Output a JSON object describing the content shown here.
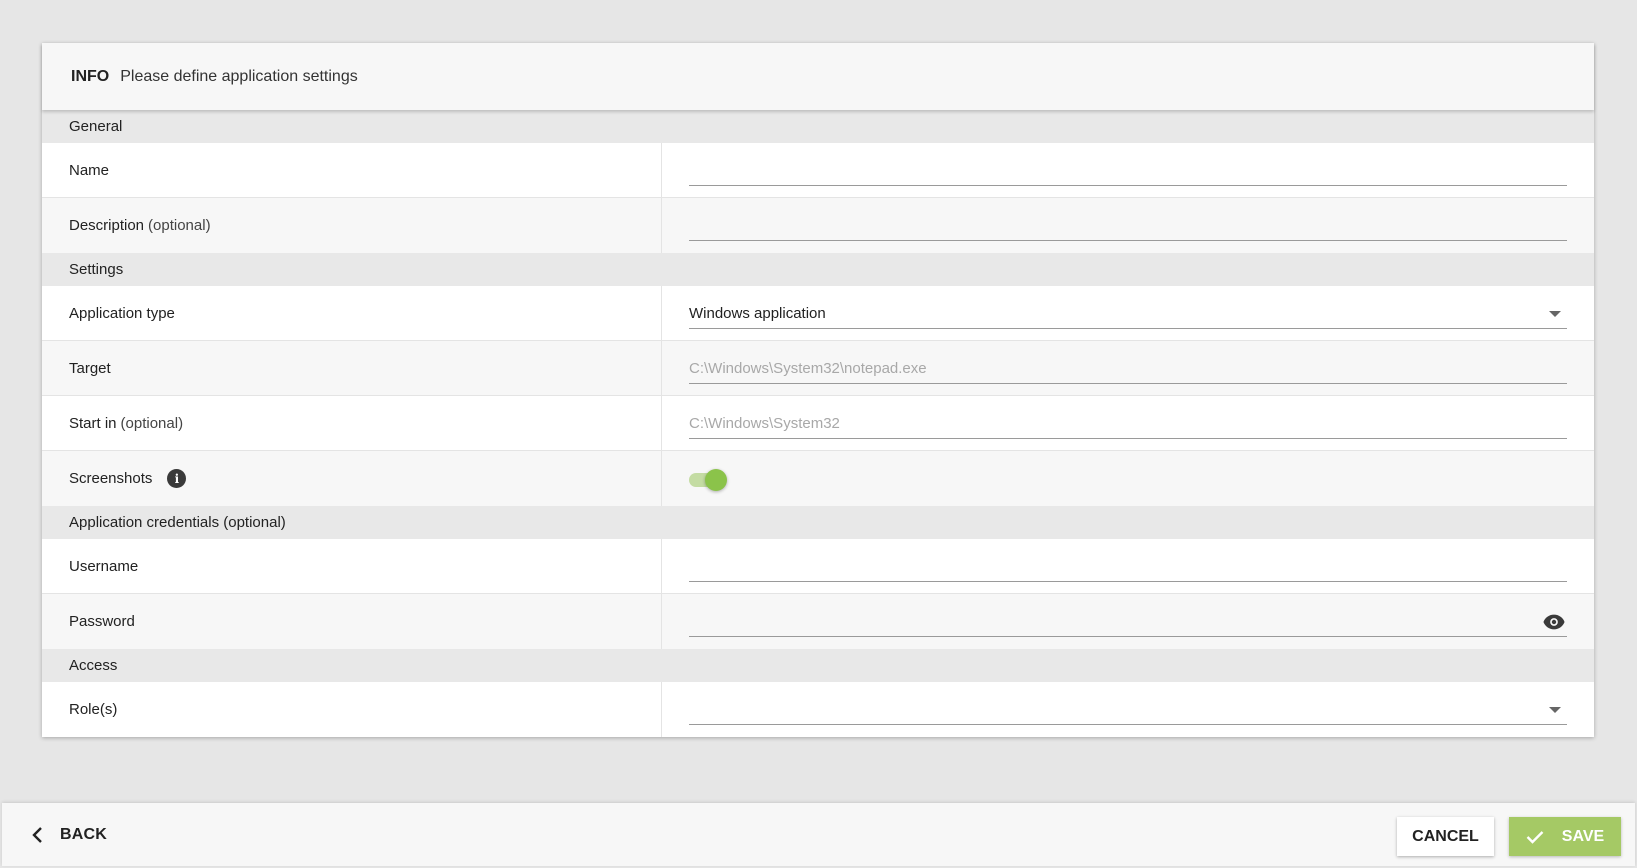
{
  "info": {
    "tag": "INFO",
    "text": "Please define application settings"
  },
  "sections": {
    "general": "General",
    "settings": "Settings",
    "credentials": "Application credentials (optional)",
    "access": "Access"
  },
  "fields": {
    "name": {
      "label": "Name",
      "value": ""
    },
    "description": {
      "label": "Description",
      "optional": "(optional)",
      "value": ""
    },
    "app_type": {
      "label": "Application type",
      "value": "Windows application"
    },
    "target": {
      "label": "Target",
      "placeholder": "C:\\Windows\\System32\\notepad.exe"
    },
    "start_in": {
      "label": "Start in",
      "optional": "(optional)",
      "placeholder": "C:\\Windows\\System32"
    },
    "screenshots": {
      "label": "Screenshots",
      "enabled": true
    },
    "username": {
      "label": "Username",
      "value": ""
    },
    "password": {
      "label": "Password",
      "value": ""
    },
    "roles": {
      "label": "Role(s)",
      "value": ""
    }
  },
  "footer": {
    "back": "BACK",
    "cancel": "CANCEL",
    "save": "SAVE"
  },
  "colors": {
    "accent": "#8bc34a",
    "save": "#a5c965",
    "toggle_track": "#c4dca3"
  }
}
